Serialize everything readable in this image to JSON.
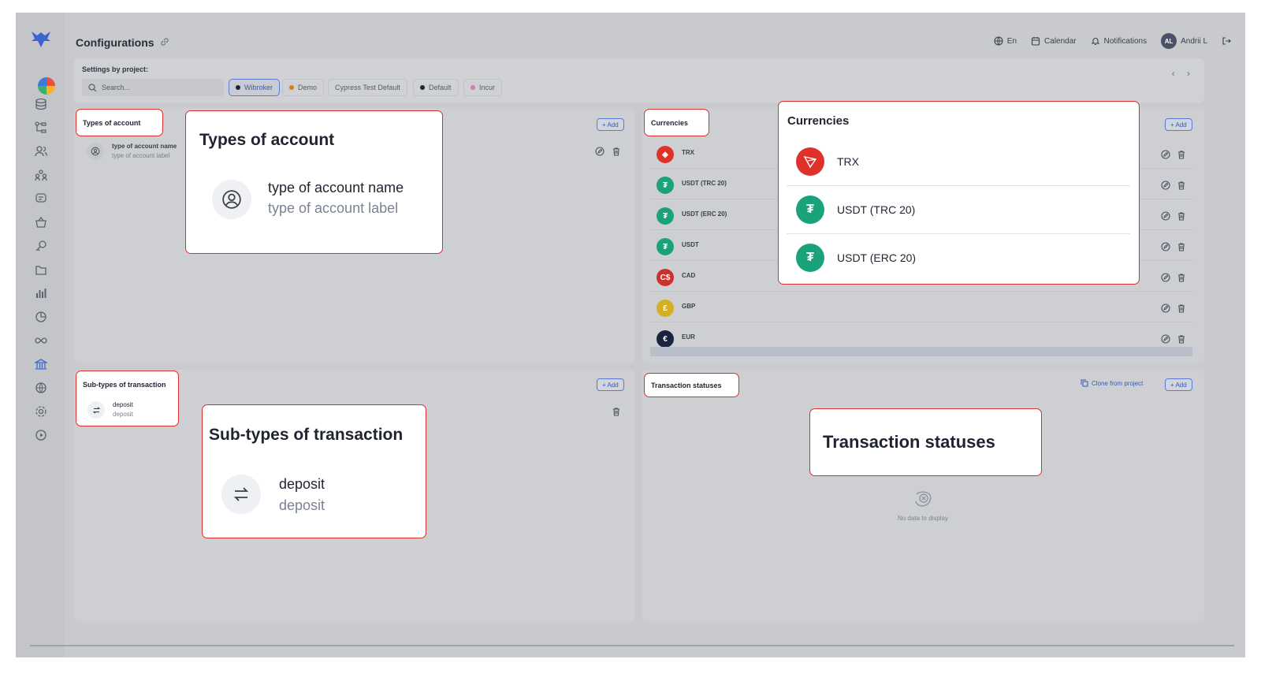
{
  "header": {
    "title": "Configurations",
    "language": "En",
    "calendar": "Calendar",
    "notifications": "Notifications",
    "avatar_initials": "AL",
    "user_name": "Andrii L"
  },
  "settings": {
    "label": "Settings by project:",
    "search_placeholder": "Search...",
    "projects": [
      {
        "label": "Wibroker",
        "color": "#1f2430",
        "selected": true
      },
      {
        "label": "Demo",
        "color": "#e07a1f",
        "selected": false
      },
      {
        "label": "Cypress Test Default",
        "color": "",
        "selected": false
      },
      {
        "label": "Default",
        "color": "#1f2430",
        "selected": false
      },
      {
        "label": "Incur",
        "color": "#d47ab8",
        "selected": false
      }
    ]
  },
  "common": {
    "add_label": "+ Add",
    "clone_label": "Clone from project"
  },
  "types_of_account": {
    "title": "Types of account",
    "item_name": "type of account name",
    "item_label": "type of account label"
  },
  "currencies": {
    "title": "Currencies",
    "items": [
      {
        "name": "TRX",
        "symbol": "◈",
        "color": "#e0302a"
      },
      {
        "name": "USDT (TRC 20)",
        "symbol": "₮",
        "color": "#1aa37a"
      },
      {
        "name": "USDT (ERC 20)",
        "symbol": "₮",
        "color": "#1aa37a"
      },
      {
        "name": "USDT",
        "symbol": "₮",
        "color": "#1aa37a"
      },
      {
        "name": "CAD",
        "symbol": "C$",
        "color": "#d0302a"
      },
      {
        "name": "GBP",
        "symbol": "£",
        "color": "#d6b020"
      },
      {
        "name": "EUR",
        "symbol": "€",
        "color": "#1a2340"
      }
    ]
  },
  "sub_types": {
    "title": "Sub-types of transaction",
    "item_name": "deposit",
    "item_label": "deposit"
  },
  "transaction_statuses": {
    "title": "Transaction statuses",
    "empty_text": "No data to display"
  }
}
